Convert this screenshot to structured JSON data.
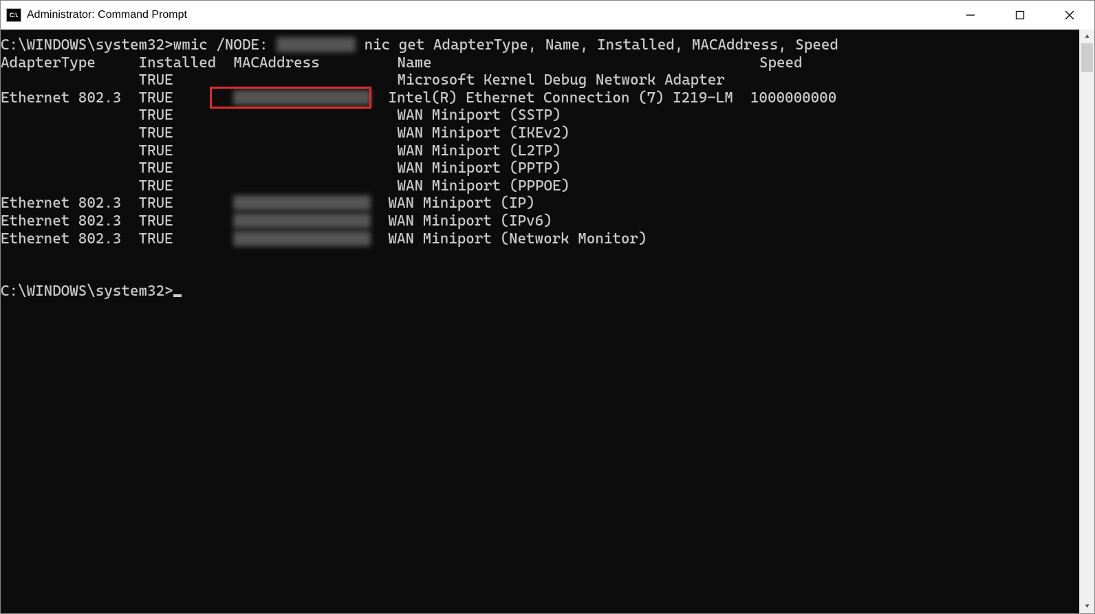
{
  "title": "Administrator: Command Prompt",
  "prompt_path": "C:\\WINDOWS\\system32>",
  "command": {
    "exe": "wmic",
    "node_flag": "/NODE:",
    "rest": "nic get AdapterType, Name, Installed, MACAddress, Speed"
  },
  "headers": {
    "adapter_type": "AdapterType",
    "installed": "Installed",
    "mac": "MACAddress",
    "name": "Name",
    "speed": "Speed"
  },
  "rows": [
    {
      "adapter_type": "",
      "installed": "TRUE",
      "mac": "",
      "name": "Microsoft Kernel Debug Network Adapter",
      "speed": ""
    },
    {
      "adapter_type": "Ethernet 802.3",
      "installed": "TRUE",
      "mac": "REDACT",
      "name": "Intel(R) Ethernet Connection (7) I219-LM",
      "speed": "1000000000",
      "highlight": true
    },
    {
      "adapter_type": "",
      "installed": "TRUE",
      "mac": "",
      "name": "WAN Miniport (SSTP)",
      "speed": ""
    },
    {
      "adapter_type": "",
      "installed": "TRUE",
      "mac": "",
      "name": "WAN Miniport (IKEv2)",
      "speed": ""
    },
    {
      "adapter_type": "",
      "installed": "TRUE",
      "mac": "",
      "name": "WAN Miniport (L2TP)",
      "speed": ""
    },
    {
      "adapter_type": "",
      "installed": "TRUE",
      "mac": "",
      "name": "WAN Miniport (PPTP)",
      "speed": ""
    },
    {
      "adapter_type": "",
      "installed": "TRUE",
      "mac": "",
      "name": "WAN Miniport (PPPOE)",
      "speed": ""
    },
    {
      "adapter_type": "Ethernet 802.3",
      "installed": "TRUE",
      "mac": "REDACT",
      "name": "WAN Miniport (IP)",
      "speed": ""
    },
    {
      "adapter_type": "Ethernet 802.3",
      "installed": "TRUE",
      "mac": "REDACT",
      "name": "WAN Miniport (IPv6)",
      "speed": ""
    },
    {
      "adapter_type": "Ethernet 802.3",
      "installed": "TRUE",
      "mac": "REDACT",
      "name": "WAN Miniport (Network Monitor)",
      "speed": ""
    }
  ],
  "cols": {
    "adapter_type": 16,
    "installed": 11,
    "mac": 19,
    "name": 42,
    "speed": 10
  }
}
